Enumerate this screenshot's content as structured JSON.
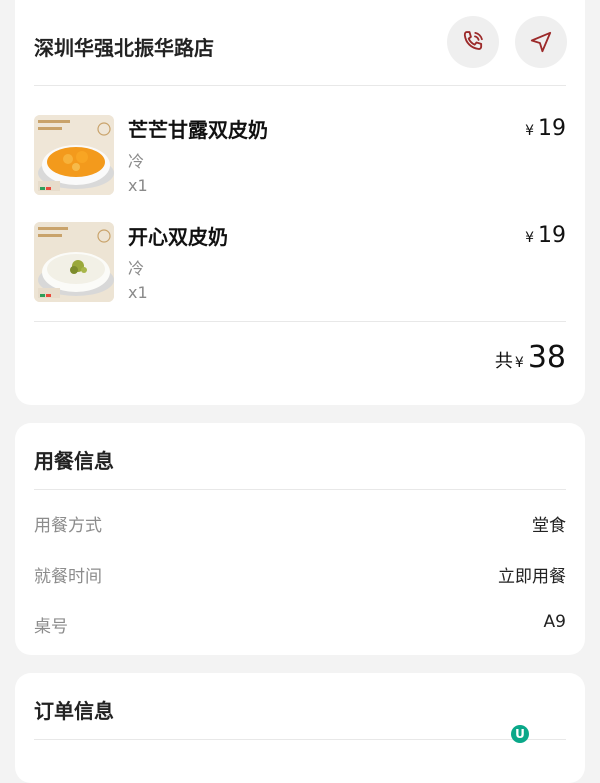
{
  "store": {
    "name": "深圳华强北振华路店",
    "call_icon": "phone-call-icon",
    "nav_icon": "navigation-arrow-icon"
  },
  "items": [
    {
      "name": "芒芒甘露双皮奶",
      "spec": "冷",
      "qty": "x1",
      "currency": "¥",
      "price": "19",
      "image": "mango-pudding-thumbnail"
    },
    {
      "name": "开心双皮奶",
      "spec": "冷",
      "qty": "x1",
      "currency": "¥",
      "price": "19",
      "image": "pistachio-milk-pudding-thumbnail"
    }
  ],
  "total": {
    "label": "共",
    "currency": "¥",
    "amount": "38"
  },
  "dining": {
    "title": "用餐信息",
    "rows": [
      {
        "label": "用餐方式",
        "value": "堂食"
      },
      {
        "label": "就餐时间",
        "value": "立即用餐"
      },
      {
        "label": "桌号",
        "value": "A9"
      }
    ]
  },
  "order": {
    "title": "订单信息"
  },
  "colors": {
    "icon_accent": "#9c2a2a",
    "background": "#f3f3f3",
    "card": "#ffffff",
    "muted_text": "#8c8c8c"
  }
}
